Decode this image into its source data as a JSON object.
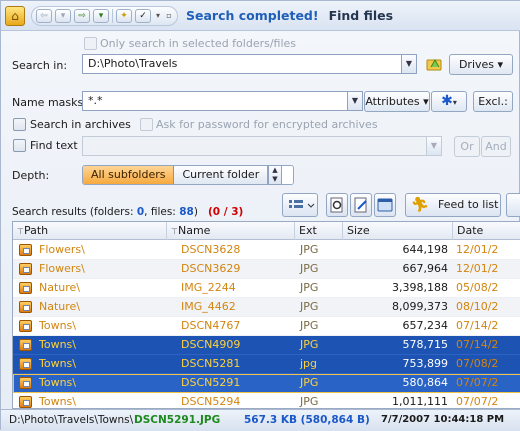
{
  "title": {
    "status": "Search completed!",
    "name": "Find files"
  },
  "colors": {
    "status": "#1f5fb8",
    "highlight_row": "#1d53b3",
    "accent_orange": "#f6a93e"
  },
  "only_selected": {
    "label": "Only search in selected folders/files"
  },
  "search_in": {
    "label": "Search in:",
    "value": "D:\\Photo\\Travels",
    "drives_label": "Drives"
  },
  "name_masks": {
    "label": "Name masks:",
    "value": "*.*",
    "attributes_label": "Attributes",
    "excl_label": "Excl.:"
  },
  "archives": {
    "label": "Search in archives",
    "password_label": "Ask for password for encrypted archives"
  },
  "find_text": {
    "label": "Find text",
    "or_label": "Or",
    "and_label": "And"
  },
  "depth": {
    "label": "Depth:",
    "all_label": "All subfolders",
    "current_label": "Current folder"
  },
  "results": {
    "prefix": "Search results (folders: ",
    "folders": "0",
    "mid": ", files: ",
    "files": "88",
    "suffix": ")",
    "errors": "(0 / 3)"
  },
  "toolbar": {
    "feed_label": "Feed to list"
  },
  "grid": {
    "columns": [
      "Path",
      "Name",
      "Ext",
      "Size",
      "Date"
    ],
    "rows": [
      {
        "path": "Flowers\\",
        "name": "DSCN3628",
        "ext": "JPG",
        "size": "644,198",
        "date": "12/01/2"
      },
      {
        "path": "Flowers\\",
        "name": "DSCN3629",
        "ext": "JPG",
        "size": "667,964",
        "date": "12/01/2"
      },
      {
        "path": "Nature\\",
        "name": "IMG_2244",
        "ext": "JPG",
        "size": "3,398,188",
        "date": "05/08/2"
      },
      {
        "path": "Nature\\",
        "name": "IMG_4462",
        "ext": "JPG",
        "size": "8,099,373",
        "date": "08/10/2"
      },
      {
        "path": "Towns\\",
        "name": "DSCN4767",
        "ext": "JPG",
        "size": "657,234",
        "date": "07/14/2"
      },
      {
        "path": "Towns\\",
        "name": "DSCN4909",
        "ext": "JPG",
        "size": "578,715",
        "date": "07/14/2"
      },
      {
        "path": "Towns\\",
        "name": "DSCN5281",
        "ext": "jpg",
        "size": "753,899",
        "date": "07/08/2"
      },
      {
        "path": "Towns\\",
        "name": "DSCN5291",
        "ext": "JPG",
        "size": "580,864",
        "date": "07/07/2"
      },
      {
        "path": "Towns\\",
        "name": "DSCN5294",
        "ext": "JPG",
        "size": "1,011,111",
        "date": "07/07/2"
      }
    ]
  },
  "status": {
    "path": "D:\\Photo\\Travels\\Towns\\",
    "file": "DSCN5291.JPG",
    "size": "567.3 KB (580,864 B)",
    "date": "7/7/2007 10:44:18 PM"
  }
}
